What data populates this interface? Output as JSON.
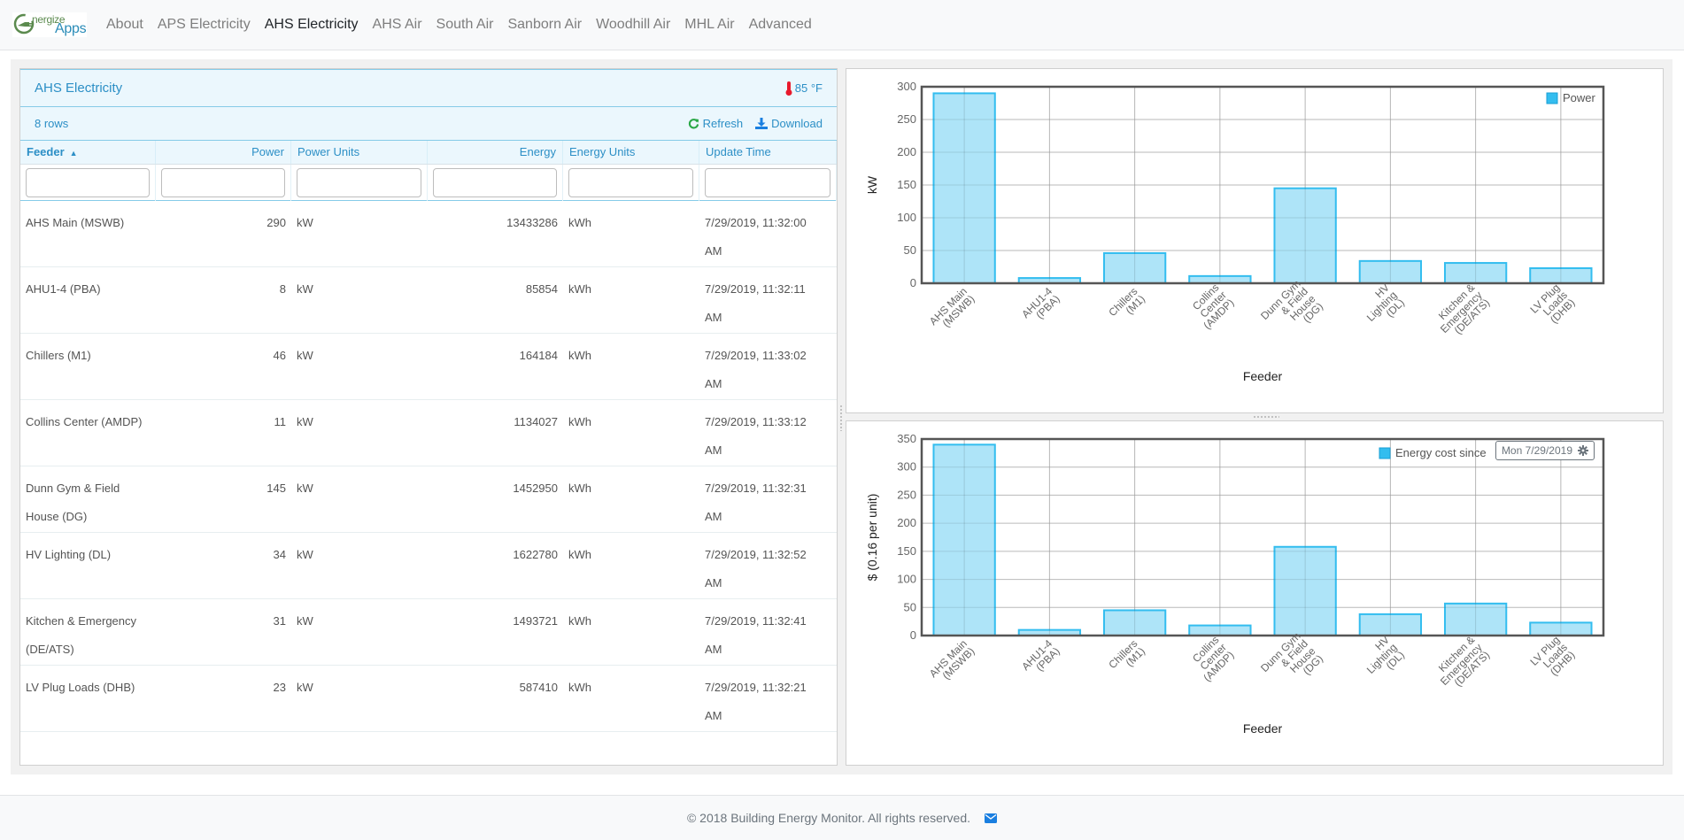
{
  "navbar": {
    "brand_line1": "nergize",
    "brand_line2": "Apps",
    "links": [
      {
        "label": "About",
        "active": false
      },
      {
        "label": "APS Electricity",
        "active": false
      },
      {
        "label": "AHS Electricity",
        "active": true
      },
      {
        "label": "AHS Air",
        "active": false
      },
      {
        "label": "South Air",
        "active": false
      },
      {
        "label": "Sanborn Air",
        "active": false
      },
      {
        "label": "Woodhill Air",
        "active": false
      },
      {
        "label": "MHL Air",
        "active": false
      },
      {
        "label": "Advanced",
        "active": false
      }
    ]
  },
  "table": {
    "title": "AHS Electricity",
    "temperature": "85 °F",
    "row_count": "8 rows",
    "refresh_label": "Refresh",
    "download_label": "Download",
    "columns": [
      "Feeder",
      "Power",
      "Power Units",
      "Energy",
      "Energy Units",
      "Update Time"
    ],
    "sort_indicator": "▲",
    "filters": [
      "",
      "",
      "",
      "",
      "",
      ""
    ],
    "rows": [
      {
        "feeder": [
          "AHS Main (MSWB)"
        ],
        "power": "290",
        "power_units": "kW",
        "energy": "13433286",
        "energy_units": "kWh",
        "time": [
          "7/29/2019, 11:32:00",
          "AM"
        ]
      },
      {
        "feeder": [
          "AHU1-4 (PBA)"
        ],
        "power": "8",
        "power_units": "kW",
        "energy": "85854",
        "energy_units": "kWh",
        "time": [
          "7/29/2019, 11:32:11",
          "AM"
        ]
      },
      {
        "feeder": [
          "Chillers (M1)"
        ],
        "power": "46",
        "power_units": "kW",
        "energy": "164184",
        "energy_units": "kWh",
        "time": [
          "7/29/2019, 11:33:02",
          "AM"
        ]
      },
      {
        "feeder": [
          "Collins Center (AMDP)"
        ],
        "power": "11",
        "power_units": "kW",
        "energy": "1134027",
        "energy_units": "kWh",
        "time": [
          "7/29/2019, 11:33:12",
          "AM"
        ]
      },
      {
        "feeder": [
          "Dunn Gym & Field",
          "House (DG)"
        ],
        "power": "145",
        "power_units": "kW",
        "energy": "1452950",
        "energy_units": "kWh",
        "time": [
          "7/29/2019, 11:32:31",
          "AM"
        ]
      },
      {
        "feeder": [
          "HV Lighting (DL)"
        ],
        "power": "34",
        "power_units": "kW",
        "energy": "1622780",
        "energy_units": "kWh",
        "time": [
          "7/29/2019, 11:32:52",
          "AM"
        ]
      },
      {
        "feeder": [
          "Kitchen & Emergency",
          "(DE/ATS)"
        ],
        "power": "31",
        "power_units": "kW",
        "energy": "1493721",
        "energy_units": "kWh",
        "time": [
          "7/29/2019, 11:32:41",
          "AM"
        ]
      },
      {
        "feeder": [
          "LV Plug Loads (DHB)"
        ],
        "power": "23",
        "power_units": "kW",
        "energy": "587410",
        "energy_units": "kWh",
        "time": [
          "7/29/2019, 11:32:21",
          "AM"
        ]
      }
    ]
  },
  "colors": {
    "accent": "#2c8fc6",
    "bar_fill": "#aae3f8",
    "bar_stroke": "#33bdef",
    "thermometer": "#e8192c",
    "refresh_icon": "#28a745",
    "mail_icon": "#1a7fe0"
  },
  "chart_data": [
    {
      "type": "bar",
      "title": "",
      "xlabel": "Feeder",
      "ylabel": "kW",
      "ylim": [
        0,
        300
      ],
      "yticks": [
        0,
        50,
        100,
        150,
        200,
        250,
        300
      ],
      "grid": true,
      "legend": "top-right",
      "categories": [
        [
          "AHS Main",
          "(MSWB)"
        ],
        [
          "AHU1-4",
          "(PBA)"
        ],
        [
          "Chillers",
          "(M1)"
        ],
        [
          "Collins",
          "Center",
          "(AMDP)"
        ],
        [
          "Dunn Gym",
          "& Field",
          "House",
          "(DG)"
        ],
        [
          "HV",
          "Lighting",
          "(DL)"
        ],
        [
          "Kitchen &",
          "Emergency",
          "(DE/ATS)"
        ],
        [
          "LV Plug",
          "Loads",
          "(DHB)"
        ]
      ],
      "series": [
        {
          "name": "Power",
          "values": [
            290,
            8,
            46,
            11,
            145,
            34,
            31,
            23
          ]
        }
      ]
    },
    {
      "type": "bar",
      "title": "",
      "xlabel": "Feeder",
      "ylabel": "$ (0.16 per unit)",
      "ylim": [
        0,
        350
      ],
      "yticks": [
        0,
        50,
        100,
        150,
        200,
        250,
        300,
        350
      ],
      "grid": true,
      "legend": "top-right",
      "legend_date": "Mon 7/29/2019",
      "categories": [
        [
          "AHS Main",
          "(MSWB)"
        ],
        [
          "AHU1-4",
          "(PBA)"
        ],
        [
          "Chillers",
          "(M1)"
        ],
        [
          "Collins",
          "Center",
          "(AMDP)"
        ],
        [
          "Dunn Gym",
          "& Field",
          "House",
          "(DG)"
        ],
        [
          "HV",
          "Lighting",
          "(DL)"
        ],
        [
          "Kitchen &",
          "Emergency",
          "(DE/ATS)"
        ],
        [
          "LV Plug",
          "Loads",
          "(DHB)"
        ]
      ],
      "series": [
        {
          "name": "Energy cost since",
          "values": [
            340,
            10,
            45,
            18,
            158,
            38,
            57,
            23
          ]
        }
      ]
    }
  ],
  "footer": {
    "text": "© 2018 Building Energy Monitor. All rights reserved."
  }
}
